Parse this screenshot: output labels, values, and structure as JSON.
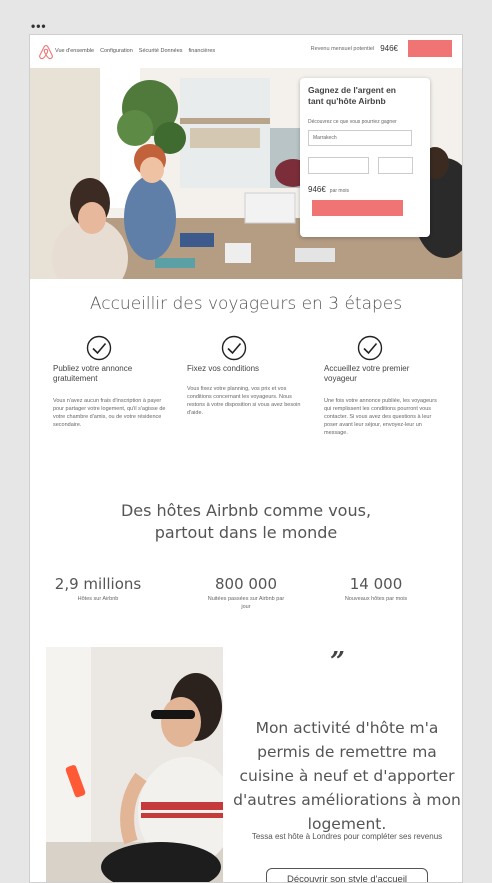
{
  "window": {
    "menu_dots": "•••"
  },
  "header": {
    "nav": [
      "Vue d'ensemble",
      "Configuration",
      "Sécurité Données",
      "financières"
    ],
    "revenue_label": "Revenu mensuel potentiel",
    "revenue_value": "946€",
    "accent_color": "#f07474"
  },
  "hero_card": {
    "title": "Gagnez de l'argent en tant qu'hôte Airbnb",
    "subtitle": "Découvrez ce que vous pourriez gagner",
    "city_value": "Marrakech",
    "estimate_value": "946€",
    "estimate_label": "par mois"
  },
  "steps": {
    "title": "Accueillir des voyageurs en 3 étapes",
    "items": [
      {
        "icon": "check-circle-icon",
        "title": "Publiez votre annonce gratuitement",
        "text": "Vous n'avez aucun frais d'inscription à payer pour partager votre logement, qu'il s'agisse de votre chambre d'amis, ou de votre résidence secondaire."
      },
      {
        "icon": "check-circle-icon",
        "title": "Fixez vos conditions",
        "text": "Vous fixez votre planning, vos prix et vos conditions concernant les voyageurs. Nous restons à votre disposition si vous avez besoin d'aide."
      },
      {
        "icon": "check-circle-icon",
        "title": "Accueillez votre premier voyageur",
        "text": "Une fois votre annonce publiée, les voyageurs qui remplissent les conditions pourront vous contacter. Si vous avez des questions à leur poser avant leur séjour, envoyez-leur un message."
      }
    ]
  },
  "hosts": {
    "title_line1": "Des hôtes Airbnb comme vous,",
    "title_line2": "partout dans le monde",
    "stats": [
      {
        "value": "2,9 millions",
        "label": "Hôtes sur Airbnb"
      },
      {
        "value": "800 000",
        "label": "Nuitées passées sur Airbnb par jour"
      },
      {
        "value": "14 000",
        "label": "Nouveaux hôtes par mois"
      }
    ]
  },
  "testimonial": {
    "quote_mark": "”",
    "quote": "Mon activité d'hôte m'a permis de remettre ma cuisine à neuf et d'apporter d'autres améliorations à mon logement.",
    "author": "Tessa est hôte à Londres pour compléter ses revenus",
    "cta": "Découvrir son style d'accueil"
  }
}
